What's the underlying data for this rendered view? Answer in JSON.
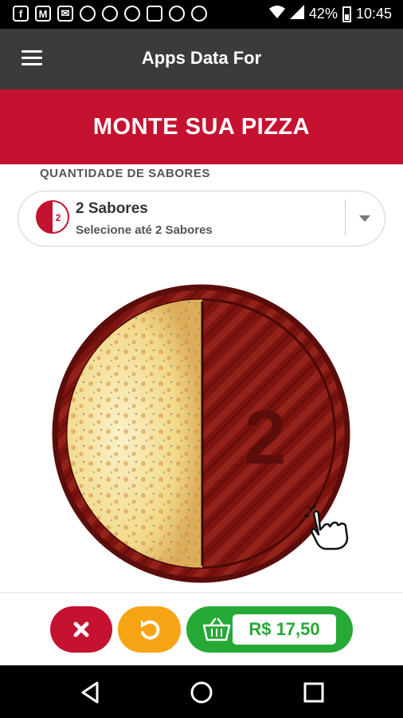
{
  "status_bar": {
    "notification_icons": [
      "facebook-icon",
      "gmail-icon",
      "email-icon",
      "clock-icon",
      "clock-icon",
      "instagram-icon",
      "news-icon",
      "clock-icon",
      "instagram-icon"
    ],
    "battery": "42%",
    "time": "10:45"
  },
  "app_bar": {
    "title": "Apps Data For"
  },
  "banner": {
    "title": "MONTE SUA PIZZA"
  },
  "flavors": {
    "section_label": "QUANTIDADE DE SABORES",
    "selected_icon_number": "2",
    "selected_label": "2 Sabores",
    "selected_hint": "Selecione até 2 Sabores"
  },
  "pizza": {
    "empty_half_number": "2"
  },
  "actions": {
    "price": "R$ 17,50"
  },
  "colors": {
    "brand_red": "#c41230",
    "reset_orange": "#f6a414",
    "cart_green": "#27a935",
    "app_bar": "#3b3b3b"
  }
}
